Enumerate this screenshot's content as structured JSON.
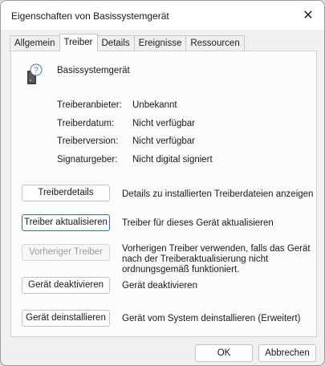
{
  "window": {
    "title": "Eigenschaften von Basissystemgerät",
    "close_glyph": "✕"
  },
  "tabs": [
    {
      "label": "Allgemein",
      "active": false
    },
    {
      "label": "Treiber",
      "active": true
    },
    {
      "label": "Details",
      "active": false
    },
    {
      "label": "Ereignisse",
      "active": false
    },
    {
      "label": "Ressourcen",
      "active": false
    }
  ],
  "device": {
    "name": "Basissystemgerät",
    "icon": "unknown-device-icon"
  },
  "properties": [
    {
      "label": "Treiberanbieter:",
      "value": "Unbekannt"
    },
    {
      "label": "Treiberdatum:",
      "value": "Nicht verfügbar"
    },
    {
      "label": "Treiberversion:",
      "value": "Nicht verfügbar"
    },
    {
      "label": "Signaturgeber:",
      "value": "Nicht digital signiert"
    }
  ],
  "actions": [
    {
      "label": "Treiberdetails",
      "description": "Details zu installierten Treiberdateien anzeigen",
      "state": "normal"
    },
    {
      "label": "Treiber aktualisieren",
      "description": "Treiber für dieses Gerät aktualisieren",
      "state": "focused"
    },
    {
      "label": "Vorheriger Treiber",
      "description": "Vorherigen Treiber verwenden, falls das Gerät nach der Treiberaktualisierung nicht ordnungsgemäß funktioniert.",
      "state": "disabled"
    },
    {
      "label": "Gerät deaktivieren",
      "description": "Gerät deaktivieren",
      "state": "normal"
    },
    {
      "label": "Gerät deinstallieren",
      "description": "Gerät vom System deinstallieren (Erweitert)",
      "state": "normal"
    }
  ],
  "footer": {
    "ok_label": "OK",
    "cancel_label": "Abbrechen"
  }
}
